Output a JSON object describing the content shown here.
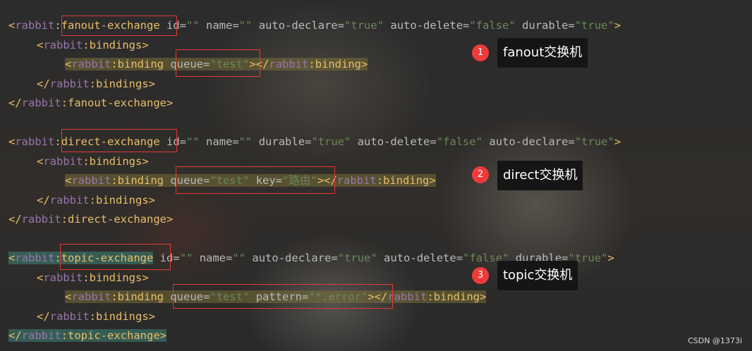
{
  "editor": {
    "lines": [
      {
        "parts": [
          {
            "t": "<",
            "c": "tagb"
          },
          {
            "t": "rabbit",
            "c": "ns"
          },
          {
            "t": ":",
            "c": "tagb"
          },
          {
            "t": "fanout-exchange",
            "c": "tagb"
          },
          {
            "t": " id",
            "c": "attr"
          },
          {
            "t": "=",
            "c": "attr"
          },
          {
            "t": "\"\"",
            "c": "val"
          },
          {
            "t": " name",
            "c": "attr"
          },
          {
            "t": "=",
            "c": "attr"
          },
          {
            "t": "\"\"",
            "c": "val"
          },
          {
            "t": " auto-declare",
            "c": "attr"
          },
          {
            "t": "=",
            "c": "attr"
          },
          {
            "t": "\"true\"",
            "c": "val"
          },
          {
            "t": " auto-delete",
            "c": "attr"
          },
          {
            "t": "=",
            "c": "attr"
          },
          {
            "t": "\"false\"",
            "c": "val"
          },
          {
            "t": " durable",
            "c": "attr"
          },
          {
            "t": "=",
            "c": "attr"
          },
          {
            "t": "\"true\"",
            "c": "val"
          },
          {
            "t": ">",
            "c": "tagb"
          }
        ]
      },
      {
        "indent": 1,
        "parts": [
          {
            "t": "<",
            "c": "tagb"
          },
          {
            "t": "rabbit",
            "c": "ns"
          },
          {
            "t": ":bindings>",
            "c": "tagb"
          }
        ]
      },
      {
        "indent": 2,
        "hl": "hl",
        "parts": [
          {
            "t": "<",
            "c": "tagb"
          },
          {
            "t": "rabbit",
            "c": "ns"
          },
          {
            "t": ":binding ",
            "c": "tagb"
          },
          {
            "t": "queue",
            "c": "attr"
          },
          {
            "t": "=",
            "c": "attr"
          },
          {
            "t": "\"test\"",
            "c": "val"
          },
          {
            "t": "></",
            "c": "tagb"
          },
          {
            "t": "rabbit",
            "c": "ns"
          },
          {
            "t": ":binding>",
            "c": "tagb"
          }
        ]
      },
      {
        "indent": 1,
        "parts": [
          {
            "t": "</",
            "c": "tagb"
          },
          {
            "t": "rabbit",
            "c": "ns"
          },
          {
            "t": ":bindings>",
            "c": "tagb"
          }
        ]
      },
      {
        "parts": [
          {
            "t": "</",
            "c": "tagb"
          },
          {
            "t": "rabbit",
            "c": "ns"
          },
          {
            "t": ":fanout-exchange>",
            "c": "tagb"
          }
        ]
      },
      {
        "parts": []
      },
      {
        "parts": [
          {
            "t": "<",
            "c": "tagb"
          },
          {
            "t": "rabbit",
            "c": "ns"
          },
          {
            "t": ":",
            "c": "tagb"
          },
          {
            "t": "direct-exchange",
            "c": "tagb"
          },
          {
            "t": " id",
            "c": "attr"
          },
          {
            "t": "=",
            "c": "attr"
          },
          {
            "t": "\"\"",
            "c": "val"
          },
          {
            "t": " name",
            "c": "attr"
          },
          {
            "t": "=",
            "c": "attr"
          },
          {
            "t": "\"\"",
            "c": "val"
          },
          {
            "t": " durable",
            "c": "attr"
          },
          {
            "t": "=",
            "c": "attr"
          },
          {
            "t": "\"true\"",
            "c": "val"
          },
          {
            "t": " auto-delete",
            "c": "attr"
          },
          {
            "t": "=",
            "c": "attr"
          },
          {
            "t": "\"false\"",
            "c": "val"
          },
          {
            "t": " auto-declare",
            "c": "attr"
          },
          {
            "t": "=",
            "c": "attr"
          },
          {
            "t": "\"true\"",
            "c": "val"
          },
          {
            "t": ">",
            "c": "tagb"
          }
        ]
      },
      {
        "indent": 1,
        "parts": [
          {
            "t": "<",
            "c": "tagb"
          },
          {
            "t": "rabbit",
            "c": "ns"
          },
          {
            "t": ":bindings>",
            "c": "tagb"
          }
        ]
      },
      {
        "indent": 2,
        "hl": "hl",
        "parts": [
          {
            "t": "<",
            "c": "tagb"
          },
          {
            "t": "rabbit",
            "c": "ns"
          },
          {
            "t": ":binding ",
            "c": "tagb"
          },
          {
            "t": "queue",
            "c": "attr"
          },
          {
            "t": "=",
            "c": "attr"
          },
          {
            "t": "\"test\"",
            "c": "val"
          },
          {
            "t": " key",
            "c": "attr"
          },
          {
            "t": "=",
            "c": "attr"
          },
          {
            "t": "\"路由\"",
            "c": "val"
          },
          {
            "t": "></",
            "c": "tagb"
          },
          {
            "t": "rabbit",
            "c": "ns"
          },
          {
            "t": ":binding>",
            "c": "tagb"
          }
        ]
      },
      {
        "indent": 1,
        "parts": [
          {
            "t": "</",
            "c": "tagb"
          },
          {
            "t": "rabbit",
            "c": "ns"
          },
          {
            "t": ":bindings>",
            "c": "tagb"
          }
        ]
      },
      {
        "parts": [
          {
            "t": "</",
            "c": "tagb"
          },
          {
            "t": "rabbit",
            "c": "ns"
          },
          {
            "t": ":direct-exchange>",
            "c": "tagb"
          }
        ]
      },
      {
        "parts": []
      },
      {
        "hl": "hl-g-start",
        "parts": [
          {
            "t": "<",
            "c": "tagb"
          },
          {
            "t": "rabbit",
            "c": "ns"
          },
          {
            "t": ":",
            "c": "tagb"
          },
          {
            "t": "topic-exchange",
            "c": "tagb"
          },
          {
            "t": " id",
            "c": "attr"
          },
          {
            "t": "=",
            "c": "attr"
          },
          {
            "t": "\"\"",
            "c": "val"
          },
          {
            "t": " name",
            "c": "attr"
          },
          {
            "t": "=",
            "c": "attr"
          },
          {
            "t": "\"\"",
            "c": "val"
          },
          {
            "t": " auto-declare",
            "c": "attr"
          },
          {
            "t": "=",
            "c": "attr"
          },
          {
            "t": "\"true\"",
            "c": "val"
          },
          {
            "t": " auto-delete",
            "c": "attr"
          },
          {
            "t": "=",
            "c": "attr"
          },
          {
            "t": "\"false\"",
            "c": "val"
          },
          {
            "t": " durable",
            "c": "attr"
          },
          {
            "t": "=",
            "c": "attr"
          },
          {
            "t": "\"true\"",
            "c": "val"
          },
          {
            "t": ">",
            "c": "tagb"
          }
        ]
      },
      {
        "indent": 1,
        "parts": [
          {
            "t": "<",
            "c": "tagb"
          },
          {
            "t": "rabbit",
            "c": "ns"
          },
          {
            "t": ":bindings>",
            "c": "tagb"
          }
        ]
      },
      {
        "indent": 2,
        "hl": "hl",
        "parts": [
          {
            "t": "<",
            "c": "tagb"
          },
          {
            "t": "rabbit",
            "c": "ns"
          },
          {
            "t": ":binding ",
            "c": "tagb"
          },
          {
            "t": "queue",
            "c": "attr"
          },
          {
            "t": "=",
            "c": "attr"
          },
          {
            "t": "\"test\"",
            "c": "val"
          },
          {
            "t": " pattern",
            "c": "attr"
          },
          {
            "t": "=",
            "c": "attr"
          },
          {
            "t": "\"*.error\"",
            "c": "val"
          },
          {
            "t": "></",
            "c": "tagb"
          },
          {
            "t": "rabbit",
            "c": "ns"
          },
          {
            "t": ":binding>",
            "c": "tagb"
          }
        ]
      },
      {
        "indent": 1,
        "parts": [
          {
            "t": "</",
            "c": "tagb"
          },
          {
            "t": "rabbit",
            "c": "ns"
          },
          {
            "t": ":bindings>",
            "c": "tagb"
          }
        ]
      },
      {
        "hl": "hl-g",
        "parts": [
          {
            "t": "</",
            "c": "tagb"
          },
          {
            "t": "rabbit",
            "c": "ns"
          },
          {
            "t": ":topic-exchange>",
            "c": "tagb"
          }
        ]
      }
    ]
  },
  "annotations": [
    {
      "num": "1",
      "label": "fanout交换机"
    },
    {
      "num": "2",
      "label": "direct交换机"
    },
    {
      "num": "3",
      "label": "topic交换机"
    }
  ],
  "watermark": "CSDN @1373i"
}
